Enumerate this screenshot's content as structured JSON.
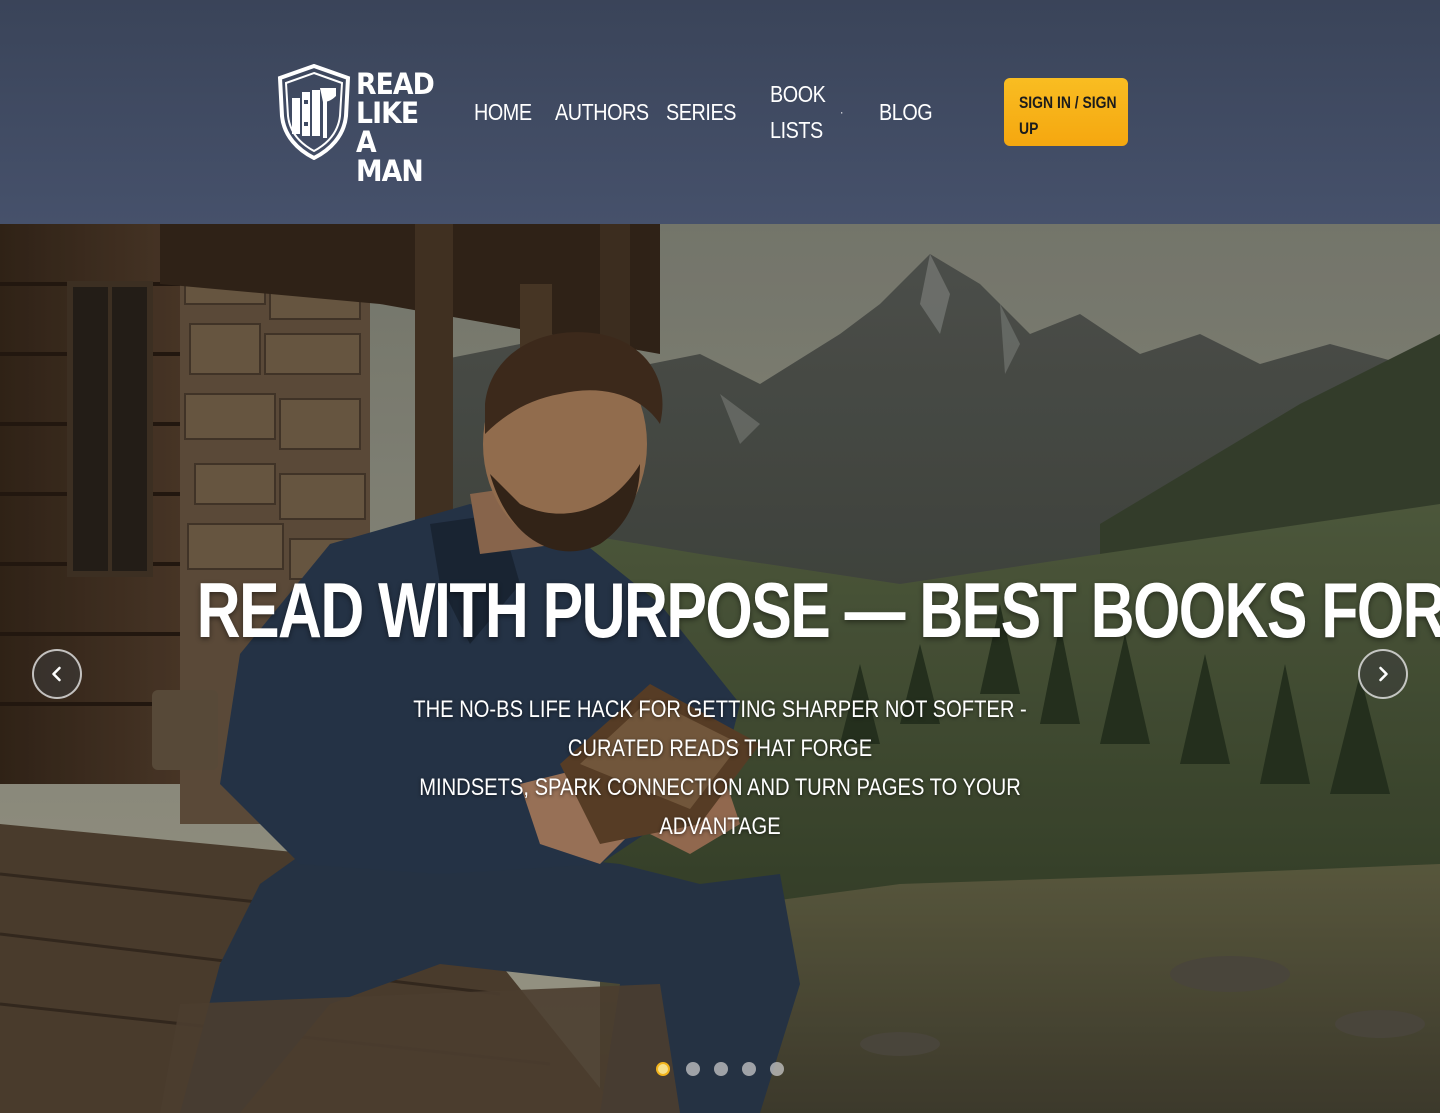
{
  "brand": {
    "logo_lines": [
      "READ",
      "LIKE A",
      "MAN"
    ],
    "logo_icon": "shield-books-axe-icon"
  },
  "nav": {
    "items": [
      {
        "label": "HOME"
      },
      {
        "label": "AUTHORS"
      },
      {
        "label": "SERIES"
      },
      {
        "label": "BOOK LISTS",
        "lines": [
          "BOOK",
          "LISTS"
        ],
        "has_dropdown": true
      },
      {
        "label": "BLOG"
      }
    ],
    "dropdown_caret": "·",
    "signin_label": "SIGN IN / SIGN UP",
    "signin_lines": [
      "SIGN IN / SIGN",
      "UP"
    ]
  },
  "hero": {
    "title": "READ WITH PURPOSE — BEST BOOKS FOR MEN",
    "subtitle_line1": "THE NO-BS LIFE HACK FOR GETTING SHARPER NOT SOFTER - CURATED READS THAT FORGE",
    "subtitle_line2": "MINDSETS, SPARK CONNECTION AND TURN PAGES TO YOUR ADVANTAGE",
    "prev_icon": "chevron-left-icon",
    "next_icon": "chevron-right-icon",
    "slide_count": 5,
    "active_slide": 1
  },
  "colors": {
    "header_bg": "#3f4a62",
    "accent": "#f5a90f",
    "text": "#ffffff"
  }
}
